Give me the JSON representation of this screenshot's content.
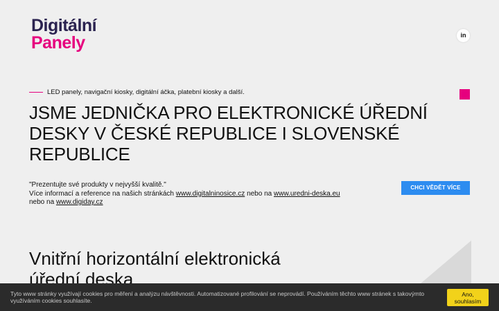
{
  "header": {
    "logo_line1": "Digitální",
    "logo_line2": "Panely",
    "social_label": "in",
    "logo_colors": {
      "primary": "#2b2350",
      "accent": "#e6007e"
    }
  },
  "hero": {
    "tagline": "LED panely, navigační kiosky, digitální áčka, platební kiosky a další.",
    "title": "JSME JEDNIČKA PRO ELEKTRONICKÉ ÚŘEDNÍ DESKY V ČESKÉ REPUBLICE I SLOVENSKÉ REPUBLICE",
    "quote": "\"Prezentujte své produkty v nejvyšší kvalitě.\"",
    "info_prefix": "Více informací a reference na našich stránkách",
    "link1": "www.digitalninosice.cz",
    "info_mid1": "nebo na",
    "link2": "www.uredni-deska.eu",
    "info_mid2": "nebo na",
    "link3": "www.digiday.cz",
    "cta_label": "CHCI VĚDĚT VÍCE",
    "cta_color": "#2d8cf0"
  },
  "section": {
    "title": "Vnitřní horizontální elektronická úřední deska"
  },
  "cookie_bar": {
    "text": "Tyto www stránky využívají cookies pro měření a analýzu návštěvnosti. Automatizované profilování se neprovádí. Používáním těchto www stránek s takovýmto využíváním cookies souhlasíte.",
    "button_line1": "Ano,",
    "button_line2": "souhlasím",
    "button_color": "#f2d21a"
  }
}
